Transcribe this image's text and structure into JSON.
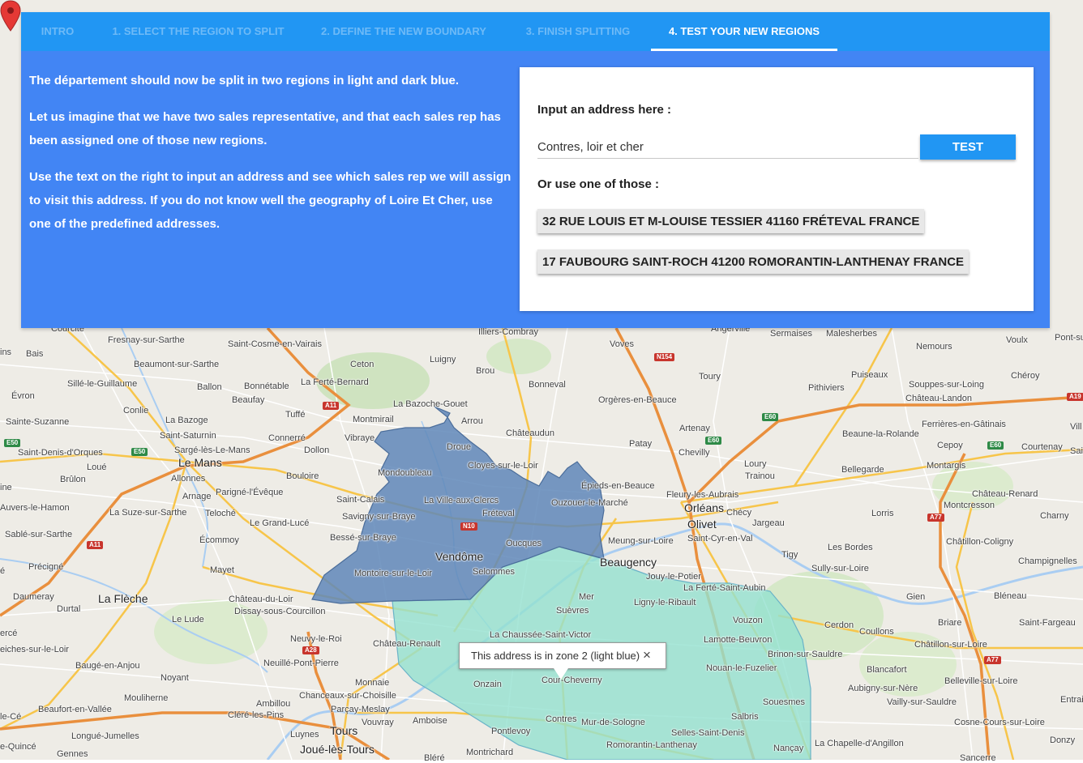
{
  "tabs": [
    {
      "label": "INTRO"
    },
    {
      "label": "1. SELECT THE REGION TO SPLIT"
    },
    {
      "label": "2. DEFINE THE NEW BOUNDARY"
    },
    {
      "label": "3. FINISH SPLITTING"
    },
    {
      "label": "4. TEST YOUR NEW REGIONS"
    }
  ],
  "description": {
    "p1": "The département should now be split in two regions in light and dark blue.",
    "p2": "Let us imagine that we have two sales representative, and that each sales rep has been assigned one of those new regions.",
    "p3": "Use the text on the right to input an address and see which sales rep we will assign to visit this address. If you do not know well the geography of Loire Et Cher, use one of the predefined addresses."
  },
  "form": {
    "input_label": "Input an address here :",
    "address_value": "Contres, loir et cher",
    "test_button": "TEST",
    "predefined_label": "Or use one of those :",
    "predefined": [
      "32 RUE LOUIS ET M-LOUISE TESSIER 41160 FRÉTEVAL FRANCE",
      "17 FAUBOURG SAINT-ROCH 41200 ROMORANTIN-LANTHENAY FRANCE"
    ]
  },
  "infowindow": {
    "text": "This address is in zone 2 (light blue)",
    "close": "×"
  },
  "colors": {
    "panel": "#4285f4",
    "tabbar": "#2196f3",
    "zone1_dark_blue": "#5f87b8",
    "zone2_light_blue": "#93e1cf",
    "marker": "#e53935"
  },
  "map": {
    "roads": {
      "a11": "A11",
      "a11b": "A11",
      "a28": "A28",
      "a77": "A77",
      "a77b": "A77",
      "a19": "A19",
      "n154": "N154",
      "n10": "N10",
      "e60a": "E60",
      "e60b": "E60",
      "e60c": "E60",
      "e50a": "E50",
      "e50b": "E50"
    },
    "places": {
      "courcite": "Courcité",
      "bais": "Bais",
      "ins": "ins",
      "fresnay": "Fresnay-sur-Sarthe",
      "saint_cosme": "Saint-Cosme-en-Vairais",
      "illiers": "Illiers-Combray",
      "angerville": "Angerville",
      "sermaises": "Sermaises",
      "malesherbes": "Malesherbes",
      "nemours": "Nemours",
      "voulx": "Voulx",
      "pont_sur": "Pont-su",
      "beaumont": "Beaumont-sur-Sarthe",
      "luigny": "Luigny",
      "voves": "Voves",
      "ceton": "Ceton",
      "brou": "Brou",
      "toury": "Toury",
      "puiseaux": "Puiseaux",
      "cheroy": "Chéroy",
      "sille": "Sillé-le-Guillaume",
      "ballon": "Ballon",
      "bonnetable": "Bonnétable",
      "la_ferte_bernard": "La Ferté-Bernard",
      "bonneval": "Bonneval",
      "pithiviers": "Pithiviers",
      "souppes": "Souppes-sur-Loing",
      "chateau_landon": "Château-Landon",
      "evron": "Évron",
      "beaufay": "Beaufay",
      "la_bazoche": "La Bazoche-Gouet",
      "orgeres": "Orgères-en-Beauce",
      "conlie": "Conlie",
      "tuffe": "Tuffé",
      "montmirail": "Montmirail",
      "arrou": "Arrou",
      "sainte_suzanne": "Sainte-Suzanne",
      "la_bazoge": "La Bazoge",
      "saint_saturnin": "Saint-Saturnin",
      "connerre": "Connerré",
      "vibraye": "Vibraye",
      "chateaudun": "Châteaudun",
      "artenay": "Artenay",
      "ferrieres": "Ferrières-en-Gâtinais",
      "beaune": "Beaune-la-Rolande",
      "cepoy": "Cepoy",
      "courtenay": "Courtenay",
      "sai": "Sai",
      "vill": "Vill",
      "saint_denis_orques": "Saint-Denis-d'Orques",
      "sarge": "Sargé-lès-Le-Mans",
      "dollon": "Dollon",
      "droue": "Droue",
      "patay": "Patay",
      "chevilly": "Chevilly",
      "le_mans": "Le Mans",
      "loue": "Loué",
      "mondoubleau": "Mondoubleau",
      "cloyes": "Cloyes-sur-le-Loir",
      "loury": "Loury",
      "trainou": "Trainou",
      "bellegarde": "Bellegarde",
      "montargis": "Montargis",
      "brulon": "Brûlon",
      "allonnes": "Allonnes",
      "bouloire": "Bouloire",
      "epieds": "Épieds-en-Beauce",
      "ine": "ine",
      "parigne": "Parigné-l'Évêque",
      "fleury": "Fleury-les-Aubrais",
      "chateau_renard": "Château-Renard",
      "arnage": "Arnage",
      "saint_calais": "Saint-Calais",
      "la_ville_aux_clercs": "La Ville-aux-Clercs",
      "ouzouer": "Ouzouer-le-Marché",
      "montcresson": "Montcresson",
      "auvers": "Auvers-le-Hamon",
      "la_suze": "La Suze-sur-Sarthe",
      "teloche": "Teloché",
      "savigny": "Savigny-sur-Braye",
      "freteval": "Fréteval",
      "orleans": "Orléans",
      "checy": "Chécy",
      "lorris": "Lorris",
      "charny": "Charny",
      "le_grand_luce": "Le Grand-Lucé",
      "olivet": "Olivet",
      "jargeau": "Jargeau",
      "sable": "Sablé-sur-Sarthe",
      "ecommoy": "Écommoy",
      "besse": "Bessé-sur-Braye",
      "oucques": "Oucques",
      "meung": "Meung-sur-Loire",
      "saint_cyr": "Saint-Cyr-en-Val",
      "chatillon_coligny": "Châtillon-Coligny",
      "les_bordes": "Les Bordes",
      "vendome": "Vendôme",
      "tigy": "Tigy",
      "champignelles": "Champignelles",
      "precigne": "Précigné",
      "beaugency": "Beaugency",
      "sully": "Sully-sur-Loire",
      "e_edge": "é",
      "mayet": "Mayet",
      "montoire": "Montoire-sur-le-Loir",
      "selommes": "Selommes",
      "jouy": "Jouy-le-Potier",
      "la_ferte_saint_aubin": "La Ferté-Saint-Aubin",
      "daumeray": "Daumeray",
      "la_fleche": "La Flèche",
      "chateau_du_loir": "Château-du-Loir",
      "mer": "Mer",
      "ligny": "Ligny-le-Ribault",
      "gien": "Gien",
      "bleneau": "Bléneau",
      "durtal": "Durtal",
      "dissay": "Dissay-sous-Courcillon",
      "suevres": "Suèvres",
      "le_lude": "Le Lude",
      "vouzon": "Vouzon",
      "briare": "Briare",
      "saint_fargeau": "Saint-Fargeau",
      "cerdon": "Cerdon",
      "erce": "ercé",
      "la_chaussee": "La Chaussée-Saint-Victor",
      "coullons": "Coullons",
      "neuvy": "Neuvy-le-Roi",
      "lamotte": "Lamotte-Beuvron",
      "chateau_renault": "Château-Renault",
      "brinon": "Brinon-sur-Sauldre",
      "chatillon_sur_loire": "Châtillon-sur-Loire",
      "eiches": "eiches-sur-le-Loir",
      "bauge": "Baugé-en-Anjou",
      "neuille": "Neuillé-Pont-Pierre",
      "nouan": "Nouan-le-Fuzelier",
      "blancafort": "Blancafort",
      "noyant": "Noyant",
      "monnaie": "Monnaie",
      "onzain": "Onzain",
      "cour_cheverny": "Cour-Cheverny",
      "belleville": "Belleville-sur-Loire",
      "aubigny": "Aubigny-sur-Nère",
      "mouliherne": "Mouliherne",
      "chanceaux": "Chanceaux-sur-Choisille",
      "ambillou": "Ambillou",
      "parcay": "Parçay-Meslay",
      "souesmes": "Souesmes",
      "vailly": "Vailly-sur-Sauldre",
      "entrai": "Entrai",
      "le_ce": "le-Cé",
      "beaufort": "Beaufort-en-Vallée",
      "clere": "Cléré-les-Pins",
      "vouvray": "Vouvray",
      "amboise": "Amboise",
      "contres": "Contres",
      "mur": "Mur-de-Sologne",
      "salbris": "Salbris",
      "cosne": "Cosne-Cours-sur-Loire",
      "longue": "Longué-Jumelles",
      "tours": "Tours",
      "luynes": "Luynes",
      "pontlevoy": "Pontlevoy",
      "selles": "Selles-Saint-Denis",
      "quince": "e-Quincé",
      "joue": "Joué-lès-Tours",
      "romorantin": "Romorantin-Lanthenay",
      "nancay": "Nançay",
      "la_chapelle": "La Chapelle-d'Angillon",
      "donzy": "Donzy",
      "gennes": "Gennes",
      "blere": "Bléré",
      "montrichard": "Montrichard",
      "sancerre": "Sancerre"
    }
  }
}
